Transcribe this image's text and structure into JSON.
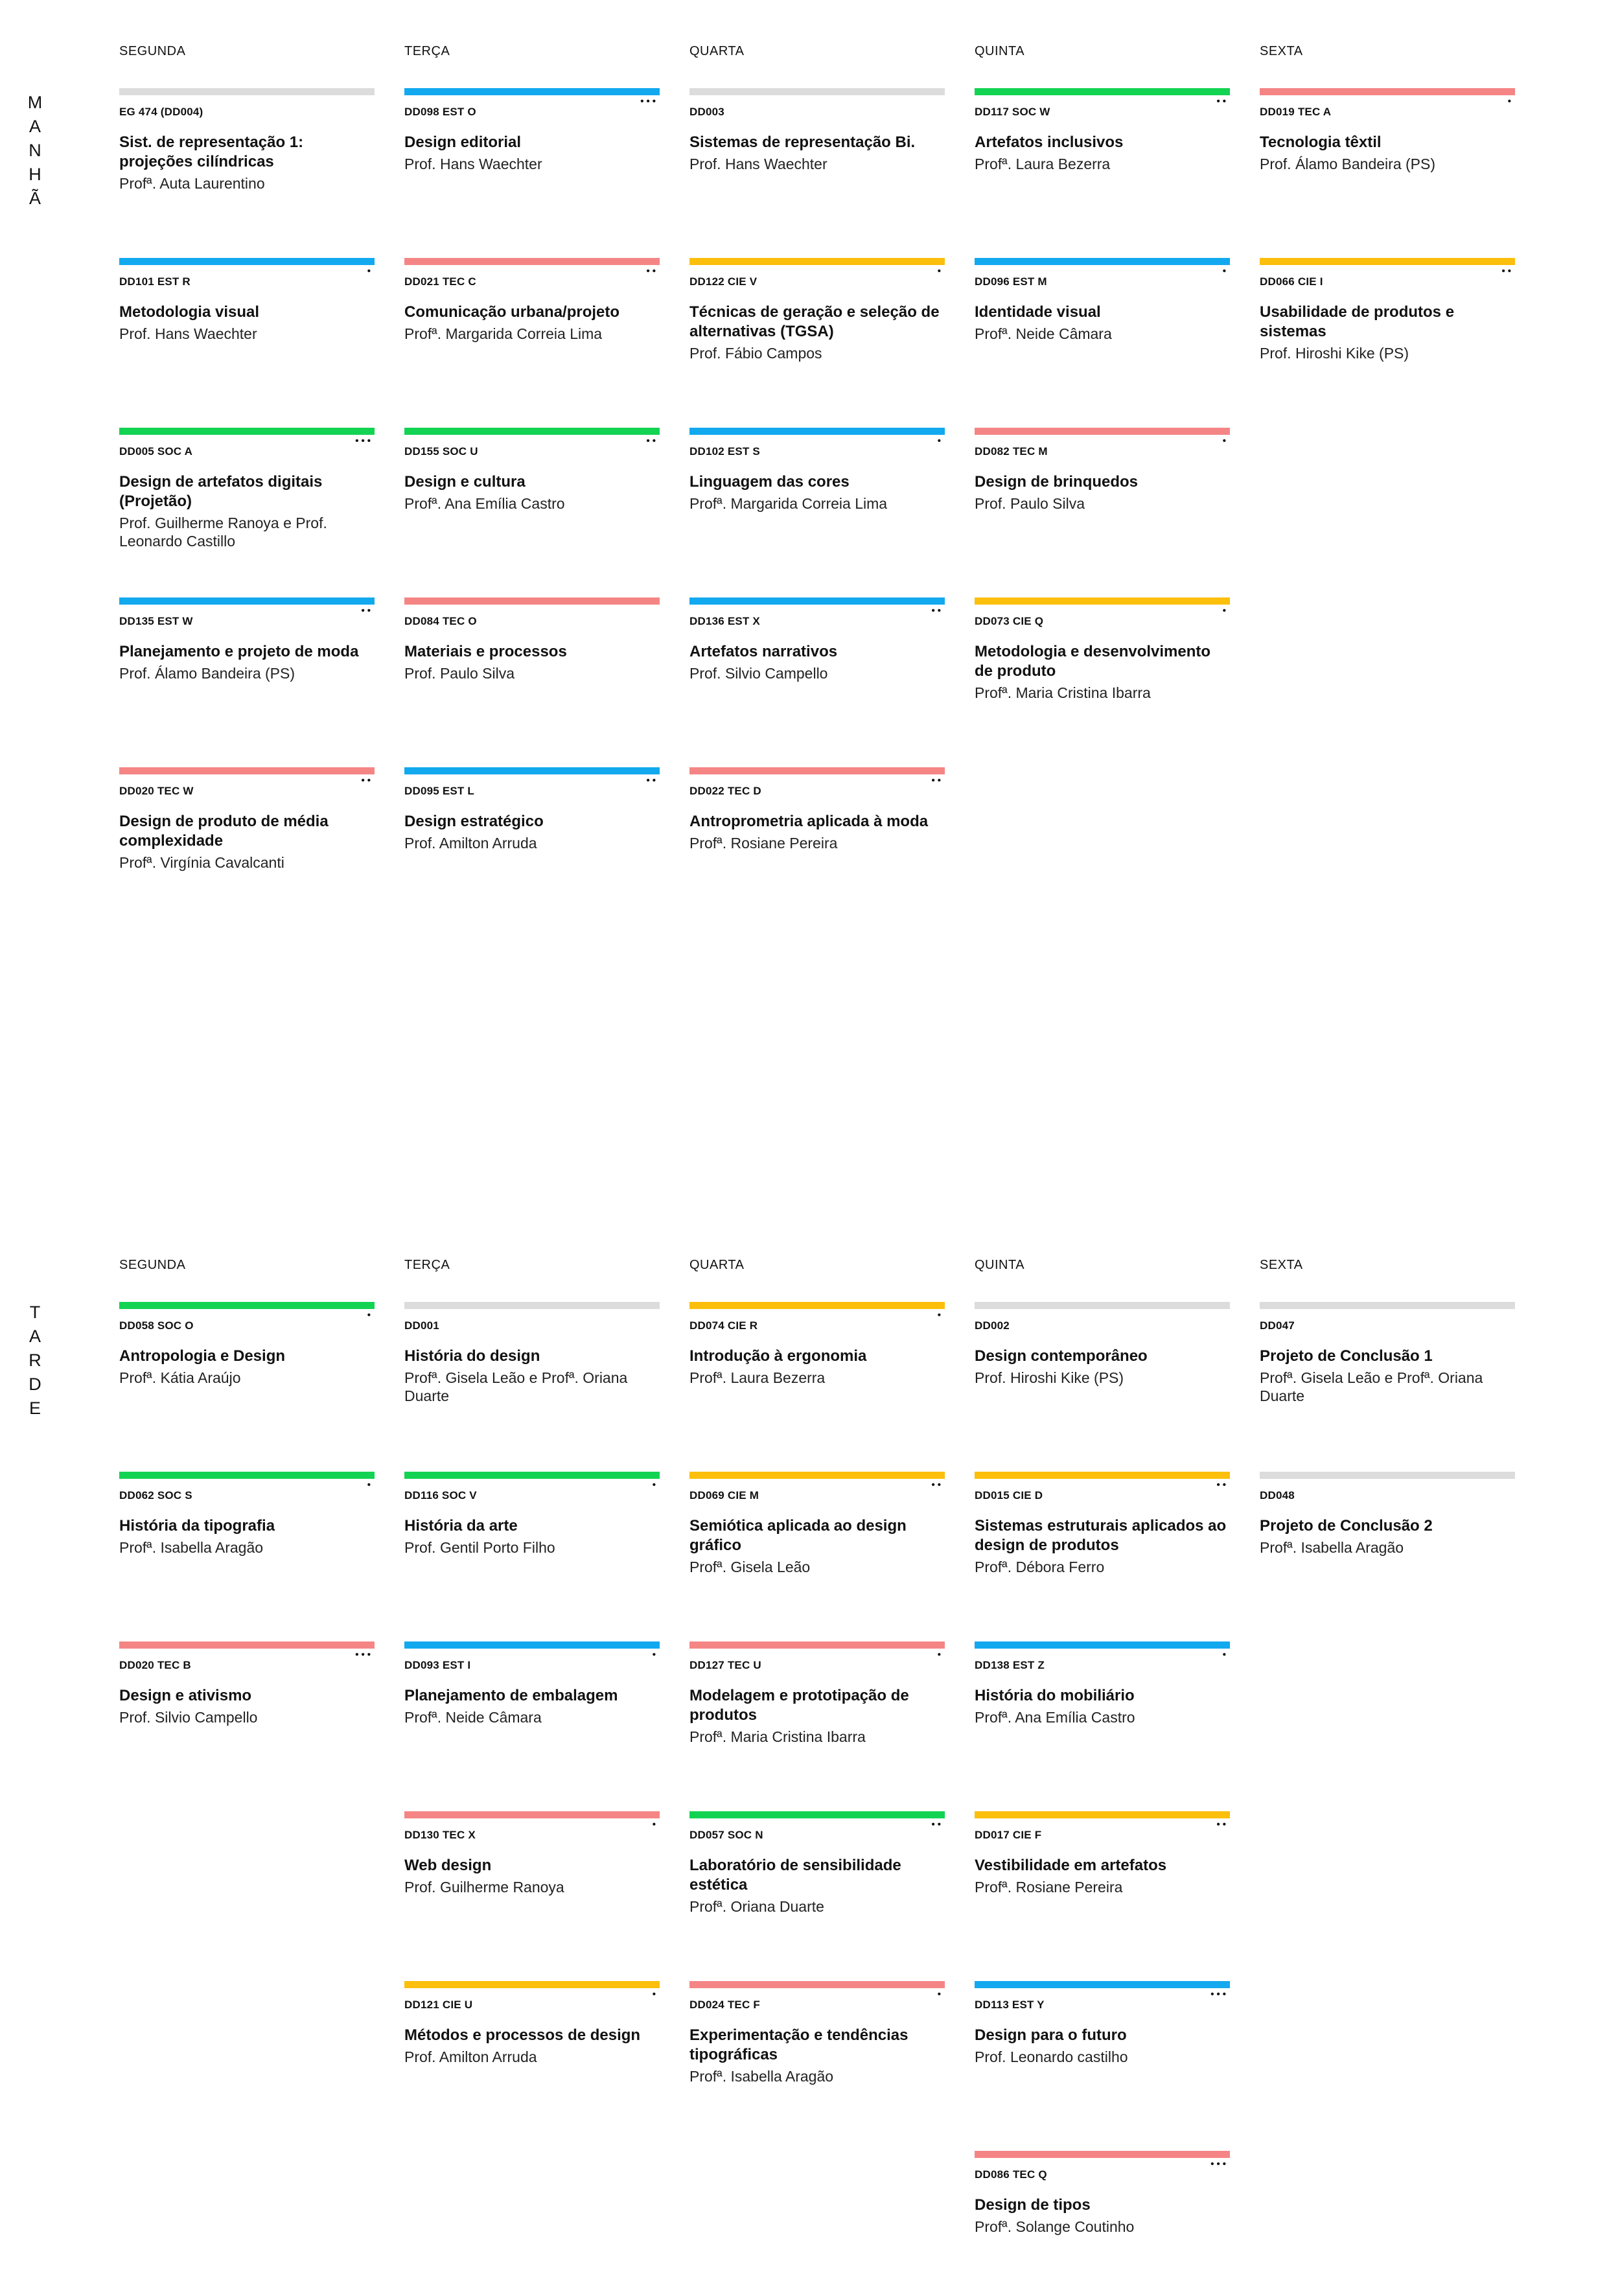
{
  "days": [
    "SEGUNDA",
    "TERÇA",
    "QUARTA",
    "QUINTA",
    "SEXTA"
  ],
  "colors": {
    "gray": "#dcdcdc",
    "blue": "#12a9ef",
    "green": "#13d353",
    "red": "#f58585",
    "yellow": "#fbbf0c"
  },
  "morning": {
    "label": [
      "M",
      "A",
      "N",
      "H",
      "Ã"
    ],
    "columns": [
      [
        {
          "color": "gray",
          "dots": "",
          "code": "EG 474 (DD004)",
          "title": "Sist. de representação 1: projeções cilíndricas",
          "prof": "Profª. Auta Laurentino"
        },
        {
          "color": "blue",
          "dots": "•",
          "code": "DD101 EST R",
          "title": "Metodologia visual",
          "prof": "Prof. Hans Waechter"
        },
        {
          "color": "green",
          "dots": "•••",
          "code": "DD005 SOC A",
          "title": "Design de artefatos digitais (Projetão)",
          "prof": "Prof. Guilherme Ranoya e Prof. Leonardo Castillo"
        },
        {
          "color": "blue",
          "dots": "••",
          "code": "DD135 EST W",
          "title": "Planejamento e projeto de moda",
          "prof": "Prof. Álamo Bandeira (PS)"
        },
        {
          "color": "red",
          "dots": "••",
          "code": "DD020 TEC W",
          "title": "Design de produto de média complexidade",
          "prof": "Profª. Virgínia Cavalcanti"
        }
      ],
      [
        {
          "color": "blue",
          "dots": "•••",
          "code": "DD098 EST O",
          "title": "Design editorial",
          "prof": "Prof. Hans Waechter"
        },
        {
          "color": "red",
          "dots": "••",
          "code": "DD021 TEC C",
          "title": "Comunicação urbana/projeto",
          "prof": "Profª. Margarida Correia Lima"
        },
        {
          "color": "green",
          "dots": "••",
          "code": "DD155 SOC U",
          "title": "Design e cultura",
          "prof": "Profª. Ana Emília Castro"
        },
        {
          "color": "red",
          "dots": "",
          "code": "DD084 TEC O",
          "title": "Materiais e processos",
          "prof": "Prof. Paulo Silva"
        },
        {
          "color": "blue",
          "dots": "••",
          "code": "DD095 EST L",
          "title": "Design estratégico",
          "prof": "Prof. Amilton Arruda"
        }
      ],
      [
        {
          "color": "gray",
          "dots": "",
          "code": "DD003",
          "title": "Sistemas de representação Bi.",
          "prof": "Prof. Hans Waechter"
        },
        {
          "color": "yellow",
          "dots": "•",
          "code": "DD122 CIE V",
          "title": "Técnicas de geração e seleção de alternativas (TGSA)",
          "prof": "Prof. Fábio Campos"
        },
        {
          "color": "blue",
          "dots": "•",
          "code": "DD102 EST S",
          "title": "Linguagem das cores",
          "prof": "Profª. Margarida Correia Lima"
        },
        {
          "color": "blue",
          "dots": "••",
          "code": "DD136 EST X",
          "title": "Artefatos narrativos",
          "prof": "Prof. Silvio Campello"
        },
        {
          "color": "red",
          "dots": "••",
          "code": "DD022 TEC D",
          "title": "Antroprometria aplicada à moda",
          "prof": "Profª. Rosiane Pereira"
        }
      ],
      [
        {
          "color": "green",
          "dots": "••",
          "code": "DD117 SOC W",
          "title": "Artefatos inclusivos",
          "prof": "Profª. Laura Bezerra"
        },
        {
          "color": "blue",
          "dots": "•",
          "code": "DD096 EST M",
          "title": "Identidade visual",
          "prof": "Profª. Neide Câmara"
        },
        {
          "color": "red",
          "dots": "•",
          "code": "DD082 TEC M",
          "title": "Design de brinquedos",
          "prof": "Prof. Paulo Silva"
        },
        {
          "color": "yellow",
          "dots": "•",
          "code": "DD073 CIE Q",
          "title": "Metodologia e desenvolvimento de produto",
          "prof": "Profª. Maria Cristina Ibarra"
        }
      ],
      [
        {
          "color": "red",
          "dots": "•",
          "code": "DD019 TEC A",
          "title": "Tecnologia têxtil",
          "prof": "Prof. Álamo Bandeira (PS)"
        },
        {
          "color": "yellow",
          "dots": "••",
          "code": "DD066 CIE I",
          "title": "Usabilidade de produtos e sistemas",
          "prof": "Prof. Hiroshi Kike (PS)"
        }
      ]
    ]
  },
  "afternoon": {
    "label": [
      "T",
      "A",
      "R",
      "D",
      "E"
    ],
    "columns": [
      [
        {
          "color": "green",
          "dots": "•",
          "code": "DD058 SOC O",
          "title": "Antropologia e Design",
          "prof": "Profª. Kátia Araújo"
        },
        {
          "color": "green",
          "dots": "•",
          "code": "DD062 SOC S",
          "title": "História da tipografia",
          "prof": "Profª. Isabella Aragão"
        },
        {
          "color": "red",
          "dots": "•••",
          "code": "DD020 TEC B",
          "title": "Design e ativismo",
          "prof": "Prof. Silvio Campello"
        }
      ],
      [
        {
          "color": "gray",
          "dots": "",
          "code": "DD001",
          "title": "História do design",
          "prof": "Profª. Gisela Leão e Profª. Oriana Duarte"
        },
        {
          "color": "green",
          "dots": "•",
          "code": "DD116 SOC V",
          "title": "História da arte",
          "prof": "Prof. Gentil Porto Filho"
        },
        {
          "color": "blue",
          "dots": "•",
          "code": "DD093 EST I",
          "title": "Planejamento de embalagem",
          "prof": "Profª. Neide Câmara"
        },
        {
          "color": "red",
          "dots": "•",
          "code": "DD130 TEC X",
          "title": "Web design",
          "prof": "Prof. Guilherme Ranoya"
        },
        {
          "color": "yellow",
          "dots": "•",
          "code": "DD121 CIE U",
          "title": "Métodos e processos de design",
          "prof": "Prof. Amilton Arruda"
        }
      ],
      [
        {
          "color": "yellow",
          "dots": "•",
          "code": "DD074 CIE R",
          "title": "Introdução à ergonomia",
          "prof": "Profª. Laura Bezerra"
        },
        {
          "color": "yellow",
          "dots": "••",
          "code": "DD069 CIE M",
          "title": "Semiótica aplicada ao design gráfico",
          "prof": "Profª. Gisela Leão"
        },
        {
          "color": "red",
          "dots": "•",
          "code": "DD127 TEC U",
          "title": "Modelagem e prototipação de produtos",
          "prof": "Profª. Maria Cristina Ibarra"
        },
        {
          "color": "green",
          "dots": "••",
          "code": "DD057 SOC N",
          "title": "Laboratório de sensibilidade estética",
          "prof": "Profª. Oriana Duarte"
        },
        {
          "color": "red",
          "dots": "•",
          "code": "DD024 TEC F",
          "title": "Experimentação e tendências tipográficas",
          "prof": "Profª. Isabella Aragão"
        }
      ],
      [
        {
          "color": "gray",
          "dots": "",
          "code": "DD002",
          "title": "Design contemporâneo",
          "prof": "Prof. Hiroshi Kike (PS)"
        },
        {
          "color": "yellow",
          "dots": "••",
          "code": "DD015 CIE D",
          "title": "Sistemas estruturais aplicados ao design de produtos",
          "prof": "Profª. Débora Ferro"
        },
        {
          "color": "blue",
          "dots": "•",
          "code": "DD138 EST Z",
          "title": "História do mobiliário",
          "prof": "Profª. Ana Emília Castro"
        },
        {
          "color": "yellow",
          "dots": "••",
          "code": "DD017 CIE F",
          "title": "Vestibilidade em artefatos",
          "prof": "Profª. Rosiane Pereira"
        },
        {
          "color": "blue",
          "dots": "•••",
          "code": "DD113 EST Y",
          "title": "Design para o futuro",
          "prof": "Prof. Leonardo castilho"
        },
        {
          "color": "red",
          "dots": "•••",
          "code": "DD086 TEC Q",
          "title": "Design de tipos",
          "prof": "Profª. Solange Coutinho"
        }
      ],
      [
        {
          "color": "gray",
          "dots": "",
          "code": "DD047",
          "title": "Projeto de Conclusão 1",
          "prof": "Profª. Gisela Leão e Profª. Oriana Duarte"
        },
        {
          "color": "gray",
          "dots": "",
          "code": "DD048",
          "title": "Projeto de Conclusão 2",
          "prof": "Profª. Isabella Aragão"
        }
      ]
    ]
  }
}
